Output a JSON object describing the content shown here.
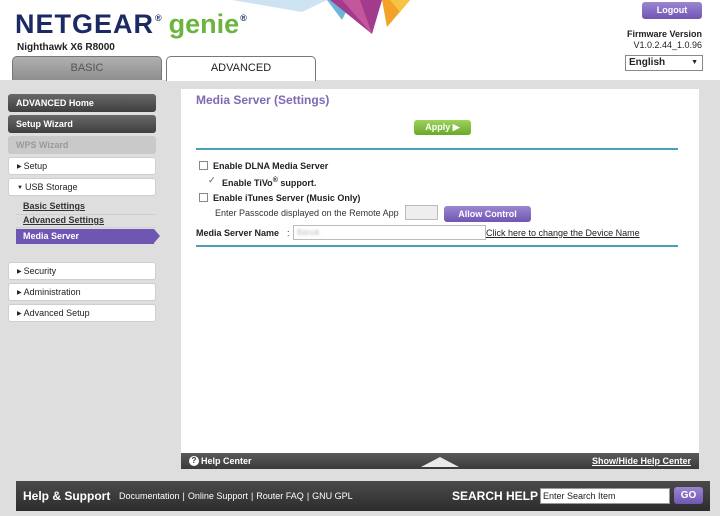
{
  "header": {
    "logo_netgear": "NETGEAR",
    "logo_reg": "®",
    "logo_genie": "genie",
    "model": "Nighthawk X6 R8000",
    "logout_label": "Logout",
    "firmware_title": "Firmware Version",
    "firmware_version": "V1.0.2.44_1.0.96",
    "language": "English",
    "tabs": [
      {
        "label": "BASIC",
        "active": false
      },
      {
        "label": "ADVANCED",
        "active": true
      }
    ]
  },
  "sidebar": {
    "advanced_home": "ADVANCED Home",
    "setup_wizard": "Setup Wizard",
    "wps_wizard": "WPS Wizard",
    "setup": "Setup",
    "usb_storage": "USB Storage",
    "usb_subitems": [
      {
        "label": "Basic Settings"
      },
      {
        "label": "Advanced Settings"
      },
      {
        "label": "Media Server",
        "active": true
      }
    ],
    "security": "Security",
    "administration": "Administration",
    "advanced_setup": "Advanced Setup",
    "collapsed_marker": "▶",
    "expanded_marker": "▼"
  },
  "content": {
    "title": "Media Server (Settings)",
    "apply_label": "Apply ▶",
    "enable_dlna": {
      "label": "Enable DLNA Media Server",
      "checked": false
    },
    "enable_tivo": {
      "label_prefix": "Enable TiVo",
      "label_sup": "®",
      "label_suffix": " support.",
      "checked": true
    },
    "enable_itunes": {
      "label": "Enable iTunes Server (Music Only)",
      "checked": false
    },
    "passcode_label": "Enter Passcode displayed on the Remote App",
    "allow_control_label": "Allow Control",
    "media_server_name_label": "Media Server Name",
    "media_server_name_colon": ":",
    "media_server_name_value": "Banuk",
    "change_device_name_link": "Click here to change the Device Name"
  },
  "help_bar": {
    "help_center": "Help Center",
    "show_hide": "Show/Hide Help Center"
  },
  "footer": {
    "title": "Help & Support",
    "links": [
      "Documentation",
      "Online Support",
      "Router FAQ",
      "GNU GPL"
    ],
    "separator": "|",
    "search_label": "SEARCH HELP",
    "search_value": "Enter Search Item",
    "go_label": "GO"
  },
  "colors": {
    "brand_navy": "#1c2a63",
    "genie_green": "#6cb33f",
    "accent_purple": "#6f56b3",
    "apply_green": "#68a82a",
    "divider_teal": "#4aa0b9"
  }
}
